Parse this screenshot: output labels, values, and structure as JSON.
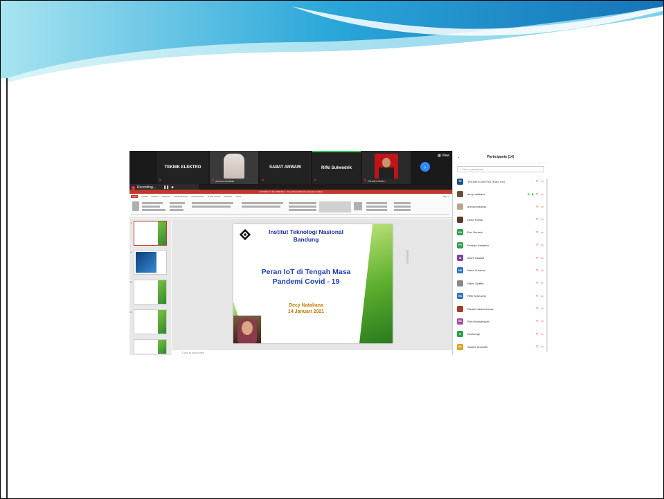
{
  "zoom": {
    "gallery": [
      {
        "name": "TEKNIK ELEKTRO",
        "type": "label"
      },
      {
        "name": "annisa maulida",
        "type": "video"
      },
      {
        "name": "SABAT ANWARI",
        "type": "label"
      },
      {
        "name": "Rifki Suhendrik",
        "type": "label"
      },
      {
        "name": "Rizadhi Abidu...",
        "type": "video"
      }
    ],
    "view_label": "View",
    "recording_label": "Recording..."
  },
  "ppt": {
    "window_title": "IoT PANE 14 Jan 2021 Baru - PowerPoint (Product Activation Failed)",
    "tabs": [
      "FILE",
      "HOME",
      "INSERT",
      "DESIGN",
      "TRANSITIONS",
      "ANIMATIONS",
      "SLIDE SHOW",
      "REVIEW",
      "VIEW"
    ],
    "sign_in": "Sign in",
    "notes_placeholder": "Click to add notes",
    "slide": {
      "institution_line1": "Institut Teknologi Nasional",
      "institution_line2": "Bandung",
      "title_line1": "Peran IoT di Tengah Masa",
      "title_line2": "Pandemi Covid - 19",
      "speaker": "Decy Nataliana",
      "date": "14 Januari 2021"
    }
  },
  "participants": {
    "header": "Participants (14)",
    "search_placeholder": "Find a participant",
    "list": [
      {
        "initials": "TE",
        "name": "TEKNIK ELEKTRO (Host, me)",
        "color": "#1f4e8c"
      },
      {
        "initials": "",
        "name": "decy nataliana",
        "color": "#6b4b3a"
      },
      {
        "initials": "",
        "name": "annisa maulida",
        "color": "#b8a48a"
      },
      {
        "initials": "",
        "name": "Dede Rohiat",
        "color": "#5a3a2a"
      },
      {
        "initials": "EN",
        "name": "Erni Nuraeni",
        "color": "#2e9e4a"
      },
      {
        "initials": "FH",
        "name": "Febrian Hadiatna",
        "color": "#2e9e4a"
      },
      {
        "initials": "IN",
        "name": "imam nawawi",
        "color": "#7a3fa8"
      },
      {
        "initials": "NS",
        "name": "Nana Subarna",
        "color": "#2d72c0"
      },
      {
        "initials": "",
        "name": "Niken Syafitri",
        "color": "#8a8a8a"
      },
      {
        "initials": "RS",
        "name": "Rifki Suhendrik",
        "color": "#2d72c0"
      },
      {
        "initials": "",
        "name": "Rizadhi Abdurrahman",
        "color": "#a83a2a"
      },
      {
        "initials": "RA",
        "name": "Rizki Andriansyah",
        "color": "#a84aa8"
      },
      {
        "initials": "R",
        "name": "Rustamaji",
        "color": "#2e9e4a"
      },
      {
        "initials": "SA",
        "name": "SABAT ANWARI",
        "color": "#e0a020"
      }
    ]
  }
}
